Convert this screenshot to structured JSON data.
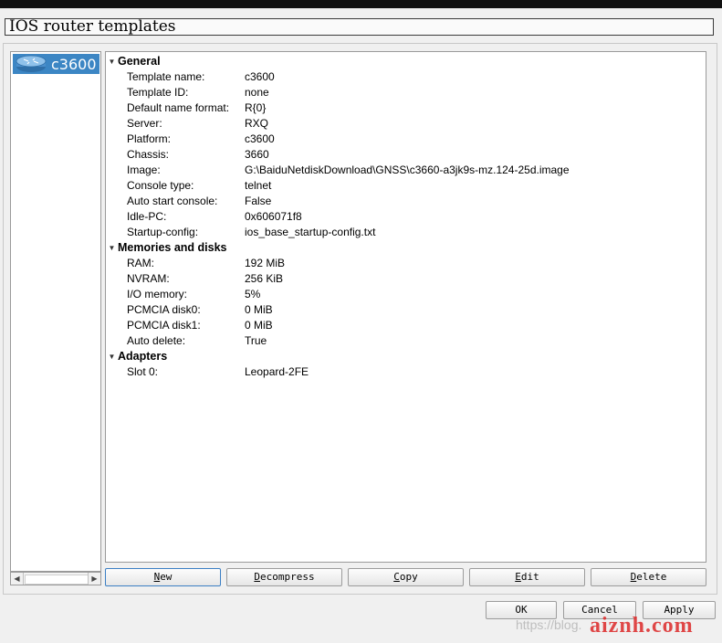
{
  "window": {
    "title": "IOS router templates"
  },
  "colors": {
    "selection": "#3c86c4",
    "background": "#f0f0f0",
    "panel": "#ffffff"
  },
  "template_list": {
    "items": [
      {
        "label": "c3600",
        "icon": "router-icon",
        "selected": true
      }
    ]
  },
  "details": {
    "sections": [
      {
        "title": "General",
        "rows": [
          {
            "key": "Template name:",
            "value": "c3600"
          },
          {
            "key": "Template ID:",
            "value": "none"
          },
          {
            "key": "Default name format:",
            "value": "R{0}"
          },
          {
            "key": "Server:",
            "value": "RXQ"
          },
          {
            "key": "Platform:",
            "value": "c3600"
          },
          {
            "key": "Chassis:",
            "value": "3660"
          },
          {
            "key": "Image:",
            "value": "G:\\BaiduNetdiskDownload\\GNSS\\c3660-a3jk9s-mz.124-25d.image"
          },
          {
            "key": "Console type:",
            "value": "telnet"
          },
          {
            "key": "Auto start console:",
            "value": "False"
          },
          {
            "key": "Idle-PC:",
            "value": "0x606071f8"
          },
          {
            "key": "Startup-config:",
            "value": "ios_base_startup-config.txt"
          }
        ]
      },
      {
        "title": "Memories and disks",
        "rows": [
          {
            "key": "RAM:",
            "value": "192 MiB"
          },
          {
            "key": "NVRAM:",
            "value": "256 KiB"
          },
          {
            "key": "I/O memory:",
            "value": "5%"
          },
          {
            "key": "PCMCIA disk0:",
            "value": "0 MiB"
          },
          {
            "key": "PCMCIA disk1:",
            "value": "0 MiB"
          },
          {
            "key": "Auto delete:",
            "value": "True"
          }
        ]
      },
      {
        "title": "Adapters",
        "rows": [
          {
            "key": "Slot 0:",
            "value": "Leopard-2FE"
          }
        ]
      }
    ]
  },
  "actions": {
    "new": {
      "mnemonic": "N",
      "rest": "ew"
    },
    "decompress": {
      "mnemonic": "D",
      "rest": "ecompress"
    },
    "copy": {
      "mnemonic": "C",
      "rest": "opy"
    },
    "edit": {
      "mnemonic": "E",
      "rest": "dit"
    },
    "delete": {
      "mnemonic": "D",
      "rest": "elete"
    }
  },
  "dialog_buttons": {
    "ok": "OK",
    "cancel": "Cancel",
    "apply": "Apply"
  },
  "watermark": {
    "faded": "https://blog.",
    "brand": "aiznh.com"
  }
}
